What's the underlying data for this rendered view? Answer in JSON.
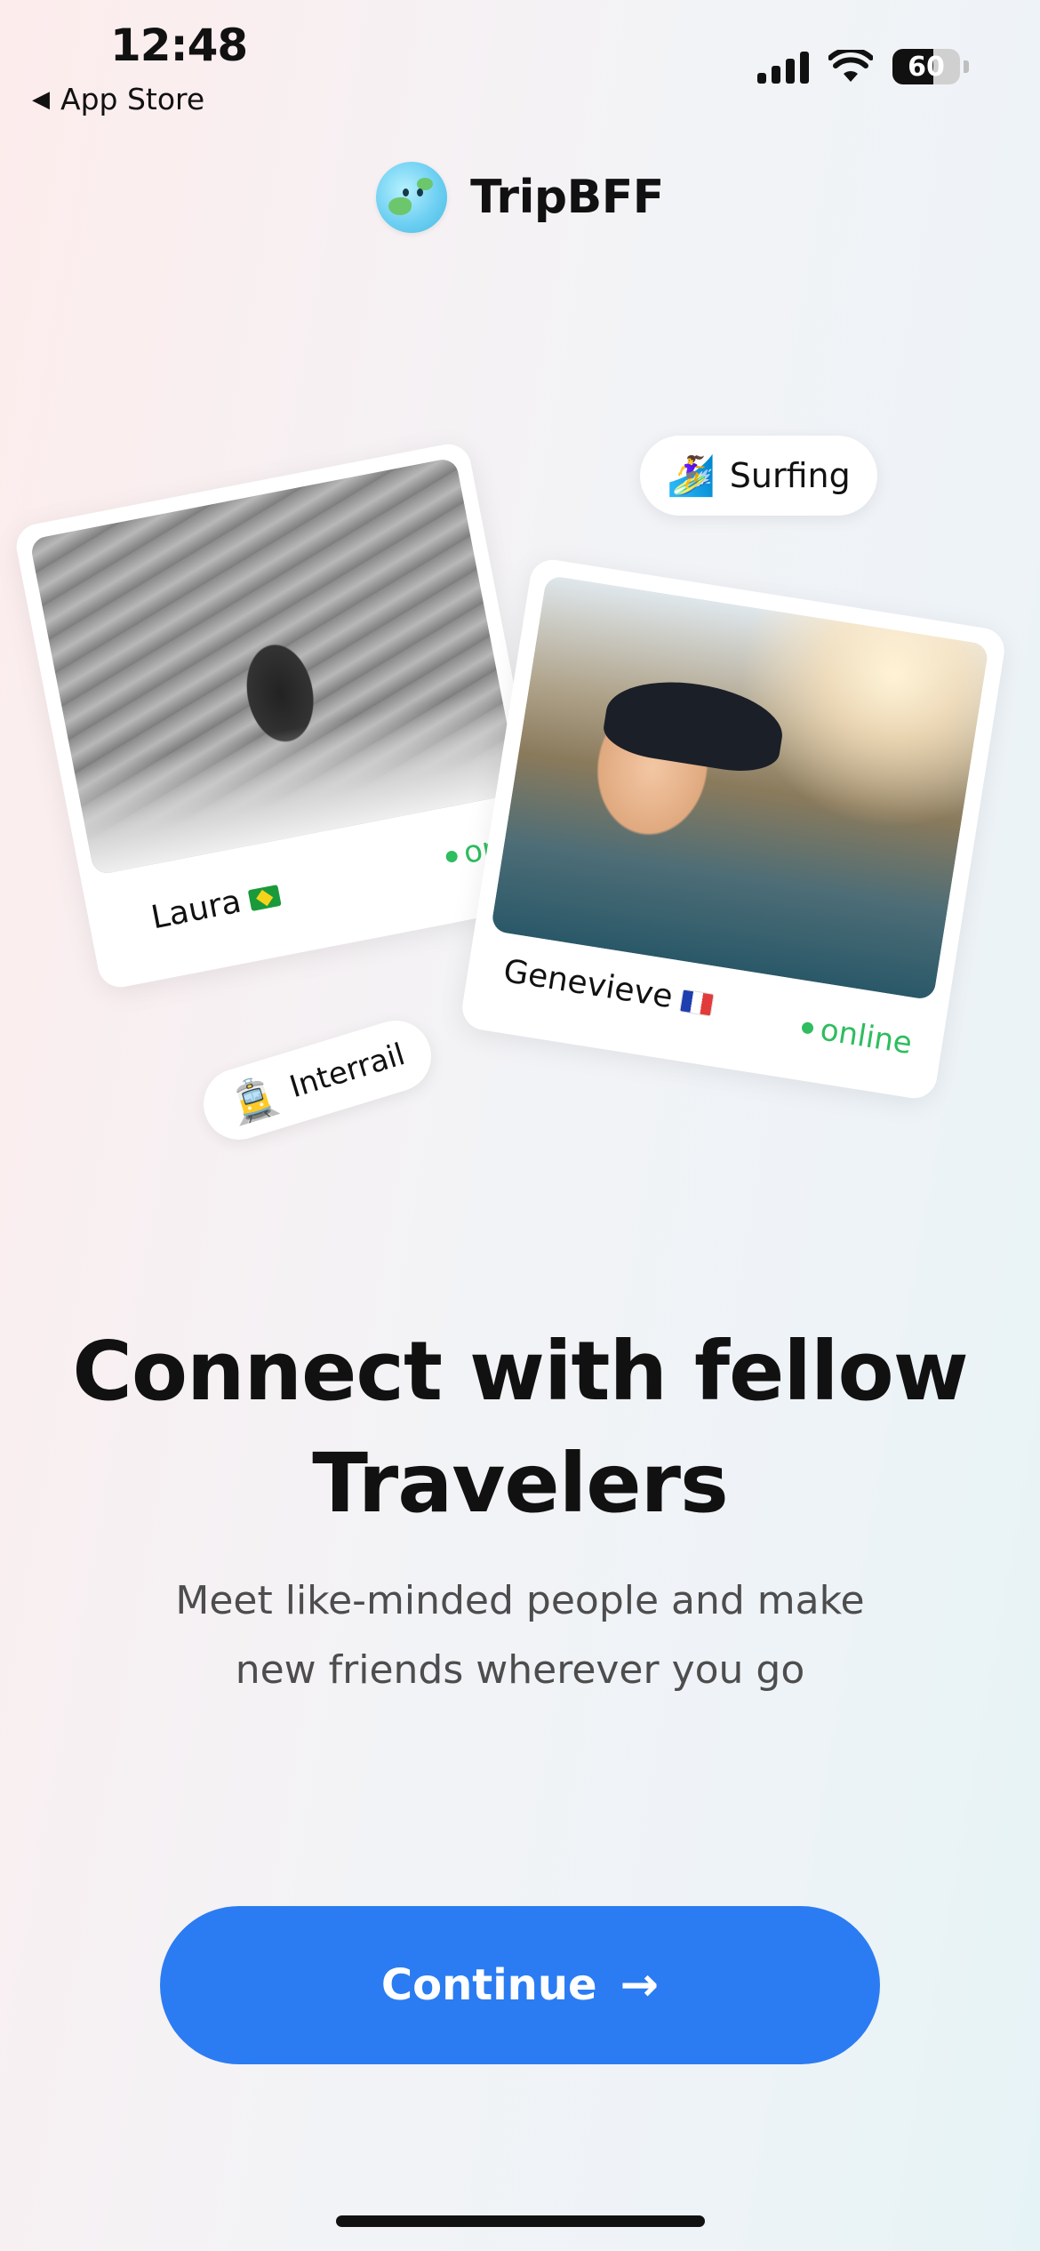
{
  "status_bar": {
    "time": "12:48",
    "back_label": "App Store",
    "battery": "60"
  },
  "brand": {
    "name": "TripBFF",
    "logo_icon": "smiling-globe-icon"
  },
  "cards": [
    {
      "name": "Laura",
      "flag": "🇧🇷",
      "status": "onli"
    },
    {
      "name": "Genevieve",
      "flag": "🇫🇷",
      "status": "online"
    }
  ],
  "chips": {
    "surfing": {
      "emoji": "🏄‍♀️",
      "label": "Surfing"
    },
    "interrail": {
      "emoji": "🚊",
      "label": "Interrail"
    }
  },
  "headline": {
    "line1": "Connect with fellow",
    "line2": "Travelers"
  },
  "subtext": {
    "line1": "Meet like-minded people and make",
    "line2": "new friends wherever you go"
  },
  "cta": {
    "label": "Continue",
    "icon": "arrow-right-icon",
    "color": "#2b7cf2"
  },
  "colors": {
    "online": "#2ebd5f",
    "text_primary": "#111111",
    "text_secondary": "#4d4d4d"
  }
}
